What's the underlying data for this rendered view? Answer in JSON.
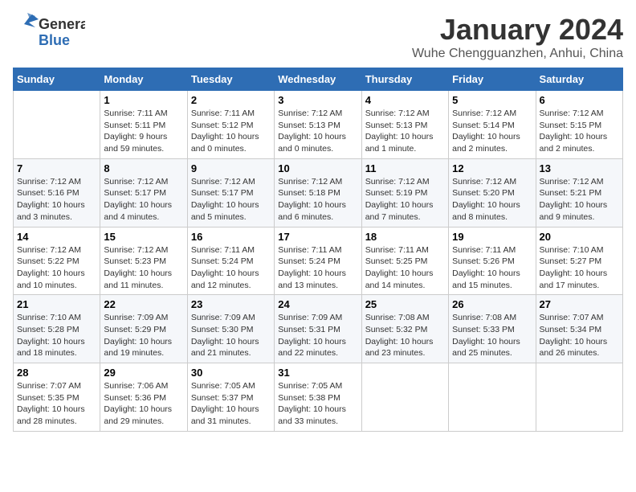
{
  "header": {
    "logo_general": "General",
    "logo_blue": "Blue",
    "month_title": "January 2024",
    "subtitle": "Wuhe Chengguanzhen, Anhui, China"
  },
  "weekdays": [
    "Sunday",
    "Monday",
    "Tuesday",
    "Wednesday",
    "Thursday",
    "Friday",
    "Saturday"
  ],
  "weeks": [
    [
      {
        "day": "",
        "info": ""
      },
      {
        "day": "1",
        "info": "Sunrise: 7:11 AM\nSunset: 5:11 PM\nDaylight: 9 hours\nand 59 minutes."
      },
      {
        "day": "2",
        "info": "Sunrise: 7:11 AM\nSunset: 5:12 PM\nDaylight: 10 hours\nand 0 minutes."
      },
      {
        "day": "3",
        "info": "Sunrise: 7:12 AM\nSunset: 5:13 PM\nDaylight: 10 hours\nand 0 minutes."
      },
      {
        "day": "4",
        "info": "Sunrise: 7:12 AM\nSunset: 5:13 PM\nDaylight: 10 hours\nand 1 minute."
      },
      {
        "day": "5",
        "info": "Sunrise: 7:12 AM\nSunset: 5:14 PM\nDaylight: 10 hours\nand 2 minutes."
      },
      {
        "day": "6",
        "info": "Sunrise: 7:12 AM\nSunset: 5:15 PM\nDaylight: 10 hours\nand 2 minutes."
      }
    ],
    [
      {
        "day": "7",
        "info": "Sunrise: 7:12 AM\nSunset: 5:16 PM\nDaylight: 10 hours\nand 3 minutes."
      },
      {
        "day": "8",
        "info": "Sunrise: 7:12 AM\nSunset: 5:17 PM\nDaylight: 10 hours\nand 4 minutes."
      },
      {
        "day": "9",
        "info": "Sunrise: 7:12 AM\nSunset: 5:17 PM\nDaylight: 10 hours\nand 5 minutes."
      },
      {
        "day": "10",
        "info": "Sunrise: 7:12 AM\nSunset: 5:18 PM\nDaylight: 10 hours\nand 6 minutes."
      },
      {
        "day": "11",
        "info": "Sunrise: 7:12 AM\nSunset: 5:19 PM\nDaylight: 10 hours\nand 7 minutes."
      },
      {
        "day": "12",
        "info": "Sunrise: 7:12 AM\nSunset: 5:20 PM\nDaylight: 10 hours\nand 8 minutes."
      },
      {
        "day": "13",
        "info": "Sunrise: 7:12 AM\nSunset: 5:21 PM\nDaylight: 10 hours\nand 9 minutes."
      }
    ],
    [
      {
        "day": "14",
        "info": "Sunrise: 7:12 AM\nSunset: 5:22 PM\nDaylight: 10 hours\nand 10 minutes."
      },
      {
        "day": "15",
        "info": "Sunrise: 7:12 AM\nSunset: 5:23 PM\nDaylight: 10 hours\nand 11 minutes."
      },
      {
        "day": "16",
        "info": "Sunrise: 7:11 AM\nSunset: 5:24 PM\nDaylight: 10 hours\nand 12 minutes."
      },
      {
        "day": "17",
        "info": "Sunrise: 7:11 AM\nSunset: 5:24 PM\nDaylight: 10 hours\nand 13 minutes."
      },
      {
        "day": "18",
        "info": "Sunrise: 7:11 AM\nSunset: 5:25 PM\nDaylight: 10 hours\nand 14 minutes."
      },
      {
        "day": "19",
        "info": "Sunrise: 7:11 AM\nSunset: 5:26 PM\nDaylight: 10 hours\nand 15 minutes."
      },
      {
        "day": "20",
        "info": "Sunrise: 7:10 AM\nSunset: 5:27 PM\nDaylight: 10 hours\nand 17 minutes."
      }
    ],
    [
      {
        "day": "21",
        "info": "Sunrise: 7:10 AM\nSunset: 5:28 PM\nDaylight: 10 hours\nand 18 minutes."
      },
      {
        "day": "22",
        "info": "Sunrise: 7:09 AM\nSunset: 5:29 PM\nDaylight: 10 hours\nand 19 minutes."
      },
      {
        "day": "23",
        "info": "Sunrise: 7:09 AM\nSunset: 5:30 PM\nDaylight: 10 hours\nand 21 minutes."
      },
      {
        "day": "24",
        "info": "Sunrise: 7:09 AM\nSunset: 5:31 PM\nDaylight: 10 hours\nand 22 minutes."
      },
      {
        "day": "25",
        "info": "Sunrise: 7:08 AM\nSunset: 5:32 PM\nDaylight: 10 hours\nand 23 minutes."
      },
      {
        "day": "26",
        "info": "Sunrise: 7:08 AM\nSunset: 5:33 PM\nDaylight: 10 hours\nand 25 minutes."
      },
      {
        "day": "27",
        "info": "Sunrise: 7:07 AM\nSunset: 5:34 PM\nDaylight: 10 hours\nand 26 minutes."
      }
    ],
    [
      {
        "day": "28",
        "info": "Sunrise: 7:07 AM\nSunset: 5:35 PM\nDaylight: 10 hours\nand 28 minutes."
      },
      {
        "day": "29",
        "info": "Sunrise: 7:06 AM\nSunset: 5:36 PM\nDaylight: 10 hours\nand 29 minutes."
      },
      {
        "day": "30",
        "info": "Sunrise: 7:05 AM\nSunset: 5:37 PM\nDaylight: 10 hours\nand 31 minutes."
      },
      {
        "day": "31",
        "info": "Sunrise: 7:05 AM\nSunset: 5:38 PM\nDaylight: 10 hours\nand 33 minutes."
      },
      {
        "day": "",
        "info": ""
      },
      {
        "day": "",
        "info": ""
      },
      {
        "day": "",
        "info": ""
      }
    ]
  ]
}
